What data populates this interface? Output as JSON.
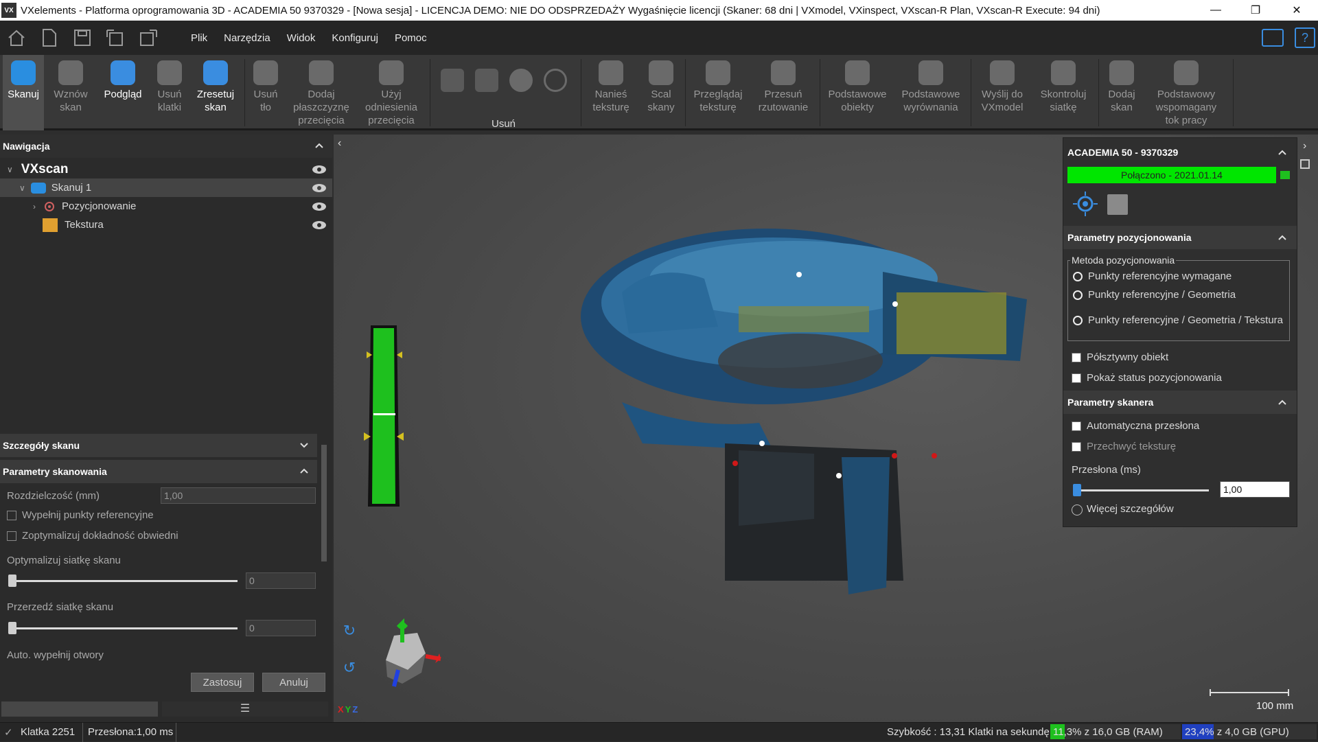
{
  "titlebar": {
    "title": "VXelements - Platforma oprogramowania 3D - ACADEMIA 50 9370329 - [Nowa sesja] - LICENCJA DEMO: NIE DO ODSPRZEDAŻY Wygaśnięcie licencji (Skaner: 68 dni | VXmodel, VXinspect, VXscan-R Plan, VXscan-R Execute: 94 dni)",
    "logo": "VX"
  },
  "menu": [
    "Plik",
    "Narzędzia",
    "Widok",
    "Konfiguruj",
    "Pomoc"
  ],
  "toolbar": {
    "buttons": [
      "Skanuj",
      "Wznów skan",
      "Podgląd",
      "Usuń klatki",
      "Zresetuj skan",
      "Usuń tło",
      "Dodaj płaszczyznę przecięcia",
      "Użyj odniesienia przecięcia",
      "Nanieś teksturę",
      "Scal skany",
      "Przeglądaj teksturę",
      "Przesuń rzutowanie",
      "Podstawowe obiekty",
      "Podstawowe wyrównania",
      "Wyślij do VXmodel",
      "Skontroluj siatkę",
      "Dodaj skan",
      "Podstawowy wspomagany tok pracy"
    ],
    "group_remove": "Usuń"
  },
  "nav": {
    "header": "Nawigacja",
    "root": "VXscan",
    "scan": "Skanuj 1",
    "positioning": "Pozycjonowanie",
    "texture": "Tekstura"
  },
  "details": {
    "header": "Szczegóły skanu",
    "params_header": "Parametry skanowania",
    "resolution_label": "Rozdzielczość (mm)",
    "resolution_value": "1,00",
    "fill_targets": "Wypełnij punkty referencyjne",
    "optimize_accuracy": "Zoptymalizuj dokładność obwiedni",
    "optimize_mesh": "Optymalizuj siatkę skanu",
    "optimize_mesh_value": "0",
    "decimate_mesh": "Przerzedź siatkę skanu",
    "decimate_mesh_value": "0",
    "auto_fill": "Auto. wypełnij otwory",
    "apply": "Zastosuj",
    "cancel": "Anuluj"
  },
  "scanner": {
    "device": "ACADEMIA 50 - 9370329",
    "connected": "Połączono - 2021.01.14",
    "pos_header": "Parametry pozycjonowania",
    "method_label": "Metoda pozycjonowania",
    "method_options": [
      "Punkty referencyjne wymagane",
      "Punkty referencyjne / Geometria",
      "Punkty referencyjne / Geometria / Tekstura"
    ],
    "semi_rigid": "Półsztywny obiekt",
    "show_status": "Pokaż status pozycjonowania",
    "scanner_header": "Parametry skanera",
    "auto_shutter": "Automatyczna przesłona",
    "capture_texture": "Przechwyć teksturę",
    "shutter_label": "Przesłona (ms)",
    "shutter_value": "1,00",
    "more_details": "Więcej szczegółów"
  },
  "viewport": {
    "scale_label": "100 mm",
    "axis_labels": [
      "X",
      "Y",
      "Z"
    ]
  },
  "status": {
    "frame": "Klatka 2251",
    "shutter": "Przesłona:1,00 ms",
    "speed": "Szybkość : 13,31 Klatki na sekundę",
    "ram": "11,3% z 16,0 GB (RAM)",
    "gpu": "23,4% z 4,0 GB (GPU)"
  },
  "colors": {
    "accent_blue": "#3a8de0",
    "connected_green": "#00e600",
    "distance_green": "#1ec01e"
  }
}
